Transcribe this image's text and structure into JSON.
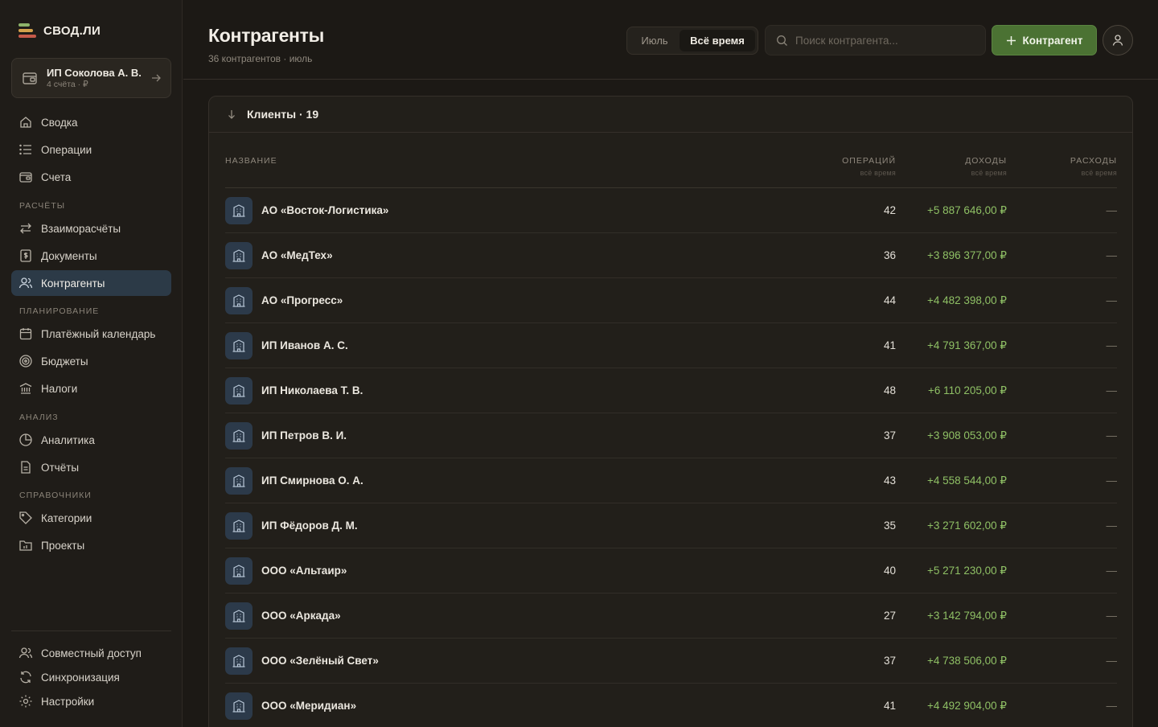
{
  "app": {
    "logo_text": "СВОД.ЛИ"
  },
  "account": {
    "name": "ИП Соколова А. В.",
    "sub": "4 счёта · ₽"
  },
  "nav": {
    "main": [
      {
        "label": "Сводка"
      },
      {
        "label": "Операции"
      },
      {
        "label": "Счета"
      }
    ],
    "section_settlements": "РАСЧЁТЫ",
    "settlements": [
      {
        "label": "Взаиморасчёты"
      },
      {
        "label": "Документы"
      },
      {
        "label": "Контрагенты"
      }
    ],
    "section_planning": "ПЛАНИРОВАНИЕ",
    "planning": [
      {
        "label": "Платёжный календарь"
      },
      {
        "label": "Бюджеты"
      },
      {
        "label": "Налоги"
      }
    ],
    "section_analysis": "АНАЛИЗ",
    "analysis": [
      {
        "label": "Аналитика"
      },
      {
        "label": "Отчёты"
      }
    ],
    "section_refs": "СПРАВОЧНИКИ",
    "refs": [
      {
        "label": "Категории"
      },
      {
        "label": "Проекты"
      }
    ],
    "bottom": [
      {
        "label": "Совместный доступ"
      },
      {
        "label": "Синхронизация"
      },
      {
        "label": "Настройки"
      }
    ]
  },
  "header": {
    "title": "Контрагенты",
    "subtitle": "36 контрагентов · июль",
    "period_month": "Июль",
    "period_all": "Всё время",
    "search_placeholder": "Поиск контрагента...",
    "add_button": "Контрагент"
  },
  "group": {
    "title": "Клиенты · 19",
    "columns": {
      "name": "НАЗВАНИЕ",
      "ops": "ОПЕРАЦИЙ",
      "ops_sub": "всё время",
      "income": "ДОХОДЫ",
      "income_sub": "всё время",
      "expense": "РАСХОДЫ",
      "expense_sub": "всё время"
    },
    "rows": [
      {
        "name": "АО «Восток-Логистика»",
        "ops": "42",
        "income": "+5 887 646,00 ₽",
        "expense": "—"
      },
      {
        "name": "АО «МедТех»",
        "ops": "36",
        "income": "+3 896 377,00 ₽",
        "expense": "—"
      },
      {
        "name": "АО «Прогресс»",
        "ops": "44",
        "income": "+4 482 398,00 ₽",
        "expense": "—"
      },
      {
        "name": "ИП Иванов А. С.",
        "ops": "41",
        "income": "+4 791 367,00 ₽",
        "expense": "—"
      },
      {
        "name": "ИП Николаева Т. В.",
        "ops": "48",
        "income": "+6 110 205,00 ₽",
        "expense": "—"
      },
      {
        "name": "ИП Петров В. И.",
        "ops": "37",
        "income": "+3 908 053,00 ₽",
        "expense": "—"
      },
      {
        "name": "ИП Смирнова О. А.",
        "ops": "43",
        "income": "+4 558 544,00 ₽",
        "expense": "—"
      },
      {
        "name": "ИП Фёдоров Д. М.",
        "ops": "35",
        "income": "+3 271 602,00 ₽",
        "expense": "—"
      },
      {
        "name": "ООО «Альтаир»",
        "ops": "40",
        "income": "+5 271 230,00 ₽",
        "expense": "—"
      },
      {
        "name": "ООО «Аркада»",
        "ops": "27",
        "income": "+3 142 794,00 ₽",
        "expense": "—"
      },
      {
        "name": "ООО «Зелёный Свет»",
        "ops": "37",
        "income": "+4 738 506,00 ₽",
        "expense": "—"
      },
      {
        "name": "ООО «Меридиан»",
        "ops": "41",
        "income": "+4 492 904,00 ₽",
        "expense": "—"
      }
    ]
  },
  "colors": {
    "accent_green": "#4b7233",
    "income_green": "#8fc065",
    "active_nav": "#2c3a47"
  }
}
